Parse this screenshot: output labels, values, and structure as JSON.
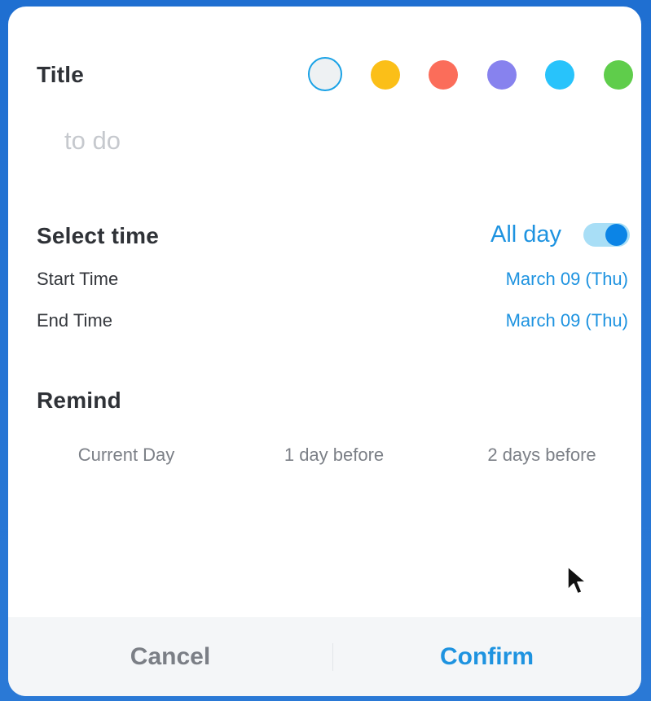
{
  "dialog": {
    "title_label": "Title",
    "title_input": {
      "value": "",
      "placeholder": "to do"
    },
    "colors": [
      {
        "name": "none",
        "hex": "#eef1f3",
        "selected": true
      },
      {
        "name": "yellow",
        "hex": "#fbbf18",
        "selected": false
      },
      {
        "name": "red",
        "hex": "#fb6d5a",
        "selected": false
      },
      {
        "name": "purple",
        "hex": "#8782ee",
        "selected": false
      },
      {
        "name": "cyan",
        "hex": "#28c3fb",
        "selected": false
      },
      {
        "name": "green",
        "hex": "#5fcd4b",
        "selected": false
      }
    ],
    "select_time": {
      "label": "Select time",
      "all_day_label": "All day",
      "all_day_on": true,
      "start_label": "Start Time",
      "start_value": "March 09 (Thu)",
      "end_label": "End Time",
      "end_value": "March 09 (Thu)"
    },
    "remind": {
      "label": "Remind",
      "options": [
        "Current Day",
        "1 day before",
        "2 days before"
      ]
    },
    "footer": {
      "cancel_label": "Cancel",
      "confirm_label": "Confirm"
    }
  },
  "theme": {
    "accent": "#1e93e0",
    "toggle_track": "#a8def6",
    "toggle_knob": "#0b84e6"
  }
}
